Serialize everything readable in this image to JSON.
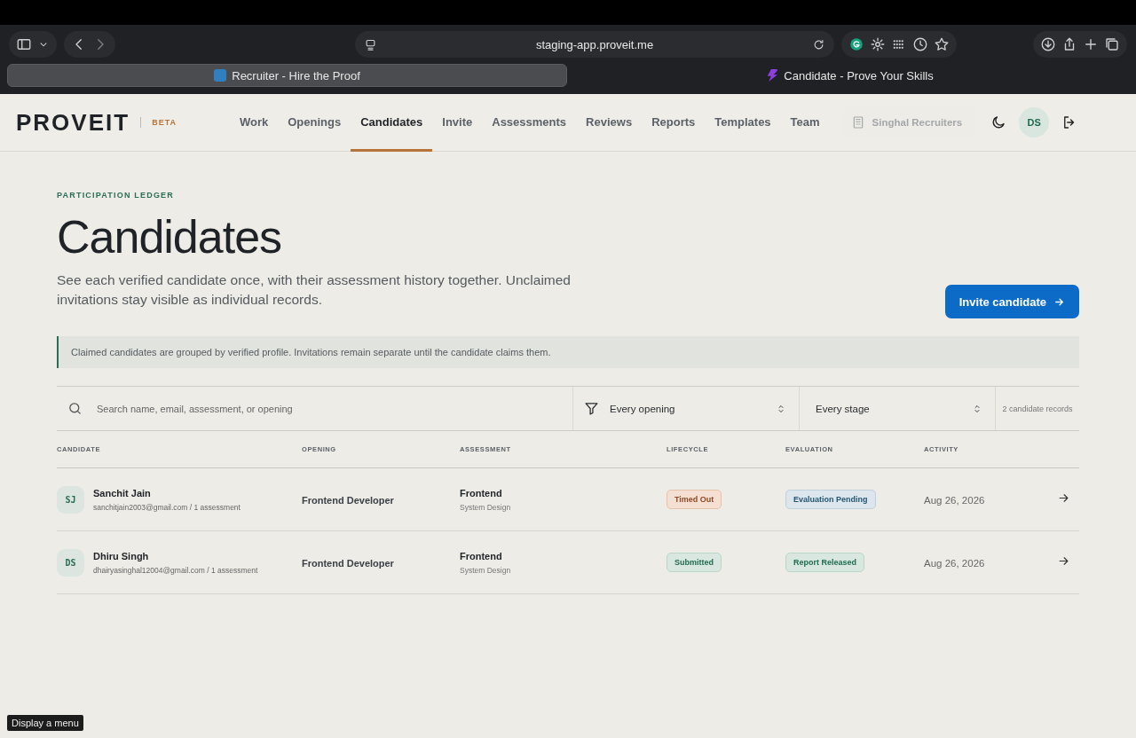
{
  "browser": {
    "url": "staging-app.proveit.me",
    "tabs": [
      {
        "label": "Recruiter - Hire the Proof",
        "selected": true
      },
      {
        "label": "Candidate - Prove Your Skills",
        "selected": false
      }
    ]
  },
  "header": {
    "logo": "PROVEIT",
    "badge": "BETA",
    "nav": [
      {
        "label": "Work",
        "selected": false
      },
      {
        "label": "Openings",
        "selected": false
      },
      {
        "label": "Candidates",
        "selected": true
      },
      {
        "label": "Invite",
        "selected": false
      },
      {
        "label": "Assessments",
        "selected": false
      },
      {
        "label": "Reviews",
        "selected": false
      },
      {
        "label": "Reports",
        "selected": false
      },
      {
        "label": "Templates",
        "selected": false
      },
      {
        "label": "Team",
        "selected": false
      }
    ],
    "workspace": "Singhal Recruiters",
    "avatar": "DS"
  },
  "page": {
    "eyebrow": "PARTICIPATION LEDGER",
    "title": "Candidates",
    "description": "See each verified candidate once, with their assessment history together. Unclaimed invitations stay visible as individual records.",
    "action": "Invite candidate",
    "notice": "Claimed candidates are grouped by verified profile. Invitations remain separate until the candidate claims them."
  },
  "filters": {
    "search_placeholder": "Search name, email, assessment, or opening",
    "opening": "Every opening",
    "stage": "Every stage",
    "count": "2 candidate records"
  },
  "table": {
    "columns": [
      "CANDIDATE",
      "OPENING",
      "ASSESSMENT",
      "LIFECYCLE",
      "EVALUATION",
      "ACTIVITY"
    ],
    "rows": [
      {
        "initials": "SJ",
        "name": "Sanchit Jain",
        "meta": "sanchitjain2003@gmail.com / 1 assessment",
        "opening": "Frontend Developer",
        "assessment": "Frontend",
        "assessment_sub": "System Design",
        "lifecycle": {
          "label": "Timed Out",
          "kind": "warning"
        },
        "evaluation": {
          "label": "Evaluation Pending",
          "kind": "info"
        },
        "activity": "Aug 26, 2026"
      },
      {
        "initials": "DS",
        "name": "Dhiru Singh",
        "meta": "dhairyasinghal12004@gmail.com / 1 assessment",
        "opening": "Frontend Developer",
        "assessment": "Frontend",
        "assessment_sub": "System Design",
        "lifecycle": {
          "label": "Submitted",
          "kind": "success"
        },
        "evaluation": {
          "label": "Report Released",
          "kind": "success"
        },
        "activity": "Aug 26, 2026"
      }
    ]
  },
  "tooltip": "Display a menu"
}
